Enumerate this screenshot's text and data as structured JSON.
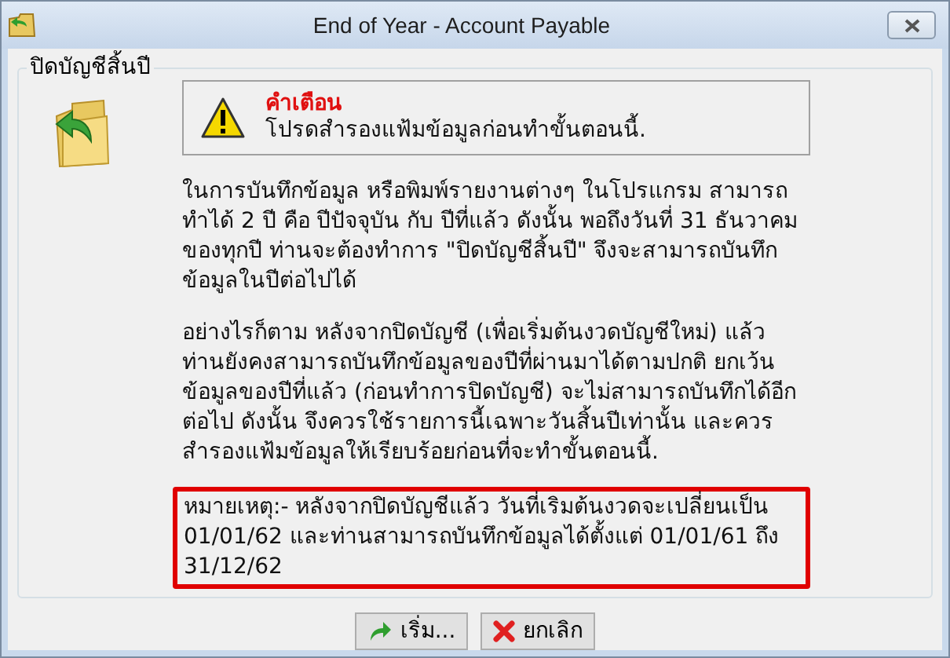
{
  "window": {
    "title": "End of Year - Account Payable"
  },
  "group": {
    "title": "ปิดบัญชีสิ้นปี"
  },
  "warning": {
    "title": "คำเตือน",
    "message": "โปรดสำรองแฟ้มข้อมูลก่อนทำขั้นตอนนี้."
  },
  "paragraphs": [
    "ในการบันทึกข้อมูล หรือพิมพ์รายงานต่างๆ ในโปรแกรม สามารถทำได้ 2 ปี คือ ปีปัจจุบัน กับ ปีที่แล้ว ดังนั้น พอถึงวันที่ 31 ธันวาคม ของทุกปี ท่านจะต้องทำการ \"ปิดบัญชีสิ้นปี\" จึงจะสามารถบันทึกข้อมูลในปีต่อไปได้",
    "อย่างไรก็ตาม หลังจากปิดบัญชี (เพื่อเริ่มต้นงวดบัญชีใหม่) แล้ว ท่านยังคงสามารถบันทึกข้อมูลของปีที่ผ่านมาได้ตามปกติ ยกเว้น ข้อมูลของปีที่แล้ว (ก่อนทำการปิดบัญชี) จะไม่สามารถบันทึกได้อีกต่อไป ดังนั้น จึงควรใช้รายการนี้เฉพาะวันสิ้นปีเท่านั้น และควรสำรองแฟ้มข้อมูลให้เรียบร้อยก่อนที่จะทำขั้นตอนนี้."
  ],
  "note": "หมายเหตุ:- หลังจากปิดบัญชีแล้ว วันที่เริมต้นงวดจะเปลี่ยนเป็น 01/01/62 และท่านสามารถบันทึกข้อมูลได้ตั้งแต่ 01/01/61 ถึง 31/12/62",
  "buttons": [
    {
      "label": "เริ่ม...",
      "kind": "start"
    },
    {
      "label": "ยกเลิก",
      "kind": "cancel"
    }
  ]
}
